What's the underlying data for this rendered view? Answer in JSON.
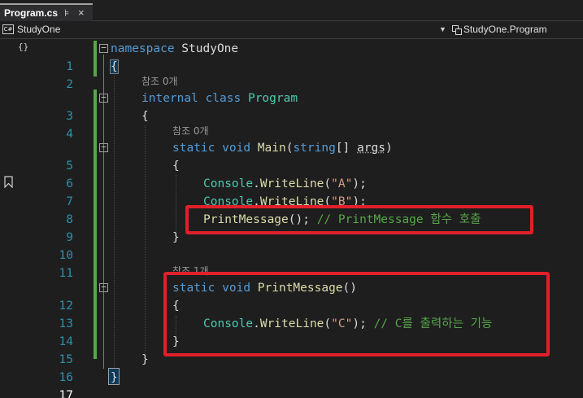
{
  "tab": {
    "title": "Program.cs",
    "pin_icon": "pin-icon",
    "close_icon": "close-icon"
  },
  "navbar": {
    "project": "StudyOne",
    "project_icon_text": "C#",
    "class_path": "StudyOne.Program"
  },
  "references": {
    "zero": "참조 0개",
    "one": "참조 1개"
  },
  "code": {
    "line1": {
      "num": "1",
      "kw": "namespace",
      "name": " StudyOne"
    },
    "line2": {
      "num": "2",
      "text": "{"
    },
    "line3": {
      "num": "3",
      "kw1": "internal",
      "kw2": "class",
      "type": "Program"
    },
    "line4": {
      "num": "4",
      "text": "{"
    },
    "line5": {
      "num": "5",
      "kw1": "static",
      "kw2": "void",
      "fn": "Main",
      "p1": "(",
      "kw3": "string",
      "p2": "[] ",
      "arg": "args",
      "p3": ")"
    },
    "line6": {
      "num": "6",
      "text": "{"
    },
    "line7": {
      "num": "7",
      "type": "Console",
      "dot": ".",
      "fn": "WriteLine",
      "p1": "(",
      "str": "\"A\"",
      "p2": ");"
    },
    "line8": {
      "num": "8",
      "type": "Console",
      "dot": ".",
      "fn": "WriteLine",
      "p1": "(",
      "str": "\"B\"",
      "p2": ");"
    },
    "line9": {
      "num": "9",
      "fn": "PrintMessage",
      "p1": "(); ",
      "comment": "// PrintMessage 함수 호출"
    },
    "line10": {
      "num": "10",
      "text": "}"
    },
    "line11": {
      "num": "11"
    },
    "line12": {
      "num": "12",
      "kw1": "static",
      "kw2": "void",
      "fn": "PrintMessage",
      "p1": "()"
    },
    "line13": {
      "num": "13",
      "text": "{"
    },
    "line14": {
      "num": "14",
      "type": "Console",
      "dot": ".",
      "fn": "WriteLine",
      "p1": "(",
      "str": "\"C\"",
      "p2": "); ",
      "comment": "// C를 출력하는 기능"
    },
    "line15": {
      "num": "15",
      "text": "}"
    },
    "line16": {
      "num": "16",
      "text": "}"
    },
    "line17": {
      "num": "17",
      "text": "}"
    }
  },
  "colors": {
    "keyword": "#569cd6",
    "type": "#4ec9b0",
    "method": "#dcdcaa",
    "string": "#d69d85",
    "comment": "#57a64a",
    "line_number": "#2b91af",
    "highlight_box": "#e0202a",
    "change_bar": "#57a64a"
  },
  "annotations": [
    "highlight-box-call",
    "highlight-box-method"
  ]
}
